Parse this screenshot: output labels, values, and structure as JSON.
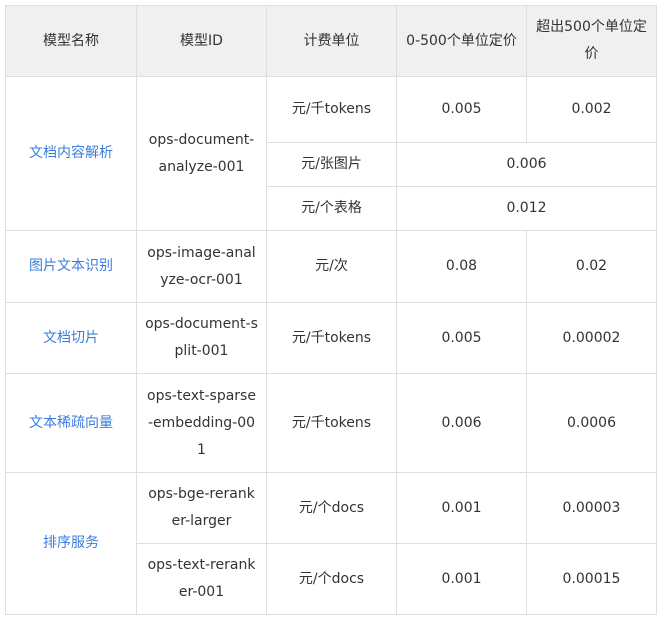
{
  "headers": [
    "模型名称",
    "模型ID",
    "计费单位",
    "0-500个单位定价",
    "超出500个单位定价"
  ],
  "rows": {
    "doc_analyze": {
      "name": "文档内容解析",
      "id": "ops-document-analyze-001",
      "r1": {
        "unit": "元/千tokens",
        "p1": "0.005",
        "p2": "0.002"
      },
      "r2": {
        "unit": "元/张图片",
        "price": "0.006"
      },
      "r3": {
        "unit": "元/个表格",
        "price": "0.012"
      }
    },
    "ocr": {
      "name": "图片文本识别",
      "id": "ops-image-analyze-ocr-001",
      "unit": "元/次",
      "p1": "0.08",
      "p2": "0.02"
    },
    "split": {
      "name": "文档切片",
      "id": "ops-document-split-001",
      "unit": "元/千tokens",
      "p1": "0.005",
      "p2": "0.00002"
    },
    "sparse": {
      "name": "文本稀疏向量",
      "id": "ops-text-sparse-embedding-001",
      "unit": "元/千tokens",
      "p1": "0.006",
      "p2": "0.0006"
    },
    "rerank": {
      "name": "排序服务",
      "r1": {
        "id": "ops-bge-reranker-larger",
        "unit": "元/个docs",
        "p1": "0.001",
        "p2": "0.00003"
      },
      "r2": {
        "id": "ops-text-reranker-001",
        "unit": "元/个docs",
        "p1": "0.001",
        "p2": "0.00015"
      }
    }
  }
}
